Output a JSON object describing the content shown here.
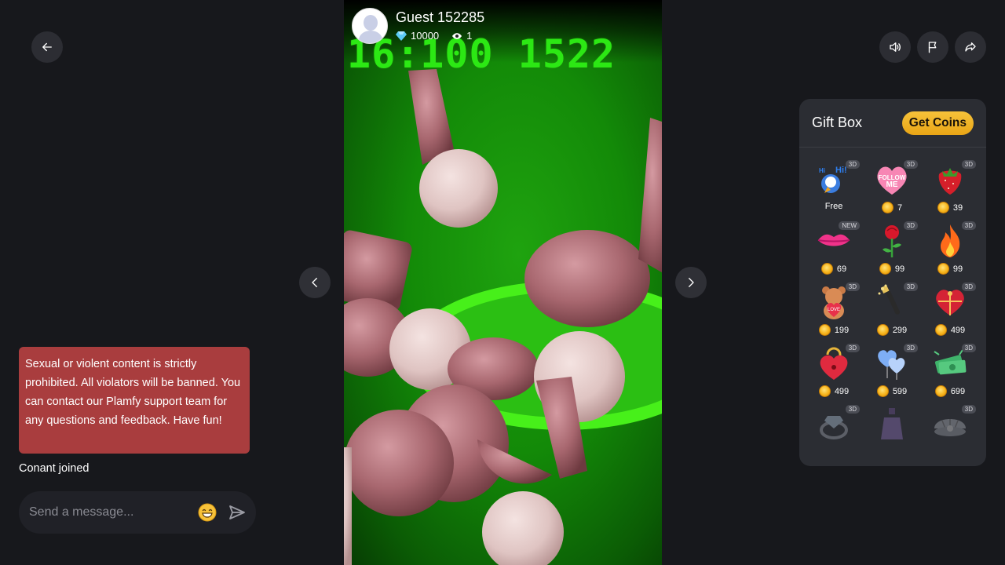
{
  "host": {
    "name": "Guest 152285",
    "diamonds": "10000",
    "viewers": "1"
  },
  "video": {
    "scoreboard_text": "16:100 1522"
  },
  "chat": {
    "notice": "Sexual or violent content is strictly prohibited. All violators will be banned. You can contact our Plamfy support team for any questions and feedback. Have fun!",
    "joined_message": "Conant joined",
    "input_placeholder": "Send a message..."
  },
  "giftbox": {
    "title": "Gift Box",
    "get_coins_label": "Get Coins",
    "gifts": [
      {
        "icon": "hi-parrot-icon",
        "badge": "3D",
        "price": "Free"
      },
      {
        "icon": "follow-me-heart-icon",
        "badge": "3D",
        "price": "7"
      },
      {
        "icon": "strawberry-icon",
        "badge": "3D",
        "price": "39"
      },
      {
        "icon": "lips-icon",
        "badge": "NEW",
        "price": "69"
      },
      {
        "icon": "rose-icon",
        "badge": "3D",
        "price": "99"
      },
      {
        "icon": "fire-icon",
        "badge": "3D",
        "price": "99"
      },
      {
        "icon": "teddy-bear-icon",
        "badge": "3D",
        "price": "199"
      },
      {
        "icon": "champagne-icon",
        "badge": "3D",
        "price": "299"
      },
      {
        "icon": "heart-chocolate-box-icon",
        "badge": "3D",
        "price": "499"
      },
      {
        "icon": "heart-lock-icon",
        "badge": "3D",
        "price": "499"
      },
      {
        "icon": "balloon-hearts-icon",
        "badge": "3D",
        "price": "599"
      },
      {
        "icon": "money-cash-icon",
        "badge": "3D",
        "price": "699"
      },
      {
        "icon": "ring-icon",
        "badge": "3D",
        "price": ""
      },
      {
        "icon": "perfume-icon",
        "badge": "",
        "price": ""
      },
      {
        "icon": "shell-pearl-icon",
        "badge": "3D",
        "price": ""
      }
    ]
  },
  "colors": {
    "background": "#17181c",
    "notice_bg": "#a93d3e",
    "panel_bg": "#2b2d33",
    "coins_gold": "#f6c23a",
    "video_green": "#138a08"
  }
}
